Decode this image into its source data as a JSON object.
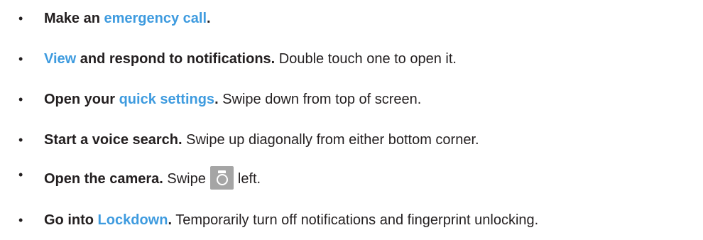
{
  "bullet_char": "•",
  "items": [
    {
      "lead": "Make an ",
      "link": "emergency call",
      "end": "."
    },
    {
      "link": "View",
      "lead": " and respond to notifications.",
      "rest": " Double touch one to open it."
    },
    {
      "lead": "Open your ",
      "link": "quick settings",
      "end": ".",
      "rest": " Swipe down from top of screen."
    },
    {
      "lead": "Start a voice search.",
      "rest": " Swipe up diagonally from either bottom corner."
    },
    {
      "lead": "Open the camera.",
      "rest_before": " Swipe",
      "icon": "camera-icon",
      "rest_after": "left."
    },
    {
      "lead": "Go into ",
      "link": "Lockdown",
      "end": ".",
      "rest": " Temporarily turn off notifications and fingerprint unlocking."
    }
  ],
  "colors": {
    "text": "#231f20",
    "link": "#3e9bdf",
    "icon_bg": "#a5a5a5"
  }
}
